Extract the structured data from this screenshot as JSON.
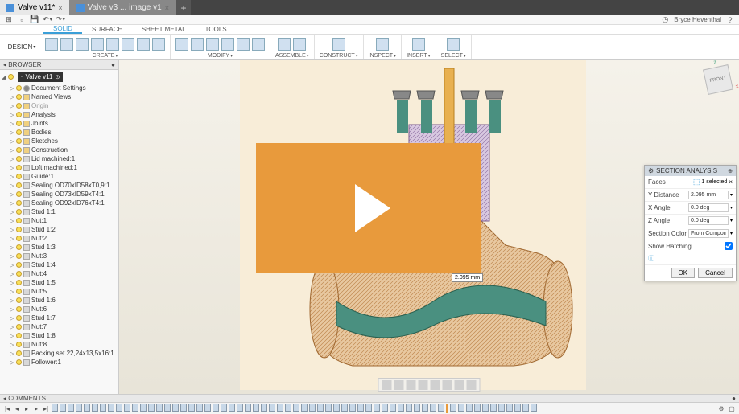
{
  "tabs": [
    {
      "title": "Valve v11*",
      "active": true
    },
    {
      "title": "Valve v3 ... image v1",
      "active": false
    }
  ],
  "user": {
    "name": "Bryce Heventhal"
  },
  "design_dropdown": "DESIGN",
  "mode_tabs": [
    "SOLID",
    "SURFACE",
    "SHEET METAL",
    "TOOLS"
  ],
  "mode_active": 0,
  "ribbon_groups": [
    {
      "label": "CREATE",
      "icon_count": 8
    },
    {
      "label": "MODIFY",
      "icon_count": 6
    },
    {
      "label": "ASSEMBLE",
      "icon_count": 2
    },
    {
      "label": "CONSTRUCT",
      "icon_count": 1
    },
    {
      "label": "INSPECT",
      "icon_count": 1
    },
    {
      "label": "INSERT",
      "icon_count": 1
    },
    {
      "label": "SELECT",
      "icon_count": 1
    }
  ],
  "browser": {
    "title": "BROWSER",
    "root": "Valve v11",
    "items": [
      {
        "label": "Document Settings",
        "type": "gear",
        "arrow": true
      },
      {
        "label": "Named Views",
        "type": "folder",
        "arrow": true
      },
      {
        "label": "Origin",
        "type": "folder",
        "arrow": true,
        "dim": true
      },
      {
        "label": "Analysis",
        "type": "folder",
        "arrow": true
      },
      {
        "label": "Joints",
        "type": "folder",
        "arrow": true
      },
      {
        "label": "Bodies",
        "type": "folder",
        "arrow": true
      },
      {
        "label": "Sketches",
        "type": "folder",
        "arrow": true
      },
      {
        "label": "Construction",
        "type": "folder",
        "arrow": true
      },
      {
        "label": "Lid machined:1",
        "type": "comp",
        "arrow": true
      },
      {
        "label": "Loft machined:1",
        "type": "comp",
        "arrow": true
      },
      {
        "label": "Guide:1",
        "type": "comp",
        "arrow": true
      },
      {
        "label": "Sealing OD70xID58xT0,9:1",
        "type": "comp",
        "arrow": true
      },
      {
        "label": "Sealing OD73xID59xT4:1",
        "type": "comp",
        "arrow": true
      },
      {
        "label": "Sealing OD92xID76xT4:1",
        "type": "comp",
        "arrow": true
      },
      {
        "label": "Stud 1:1",
        "type": "comp",
        "arrow": true
      },
      {
        "label": "Nut:1",
        "type": "comp",
        "arrow": true
      },
      {
        "label": "Stud 1:2",
        "type": "comp",
        "arrow": true
      },
      {
        "label": "Nut:2",
        "type": "comp",
        "arrow": true
      },
      {
        "label": "Stud 1:3",
        "type": "comp",
        "arrow": true
      },
      {
        "label": "Nut:3",
        "type": "comp",
        "arrow": true
      },
      {
        "label": "Stud 1:4",
        "type": "comp",
        "arrow": true
      },
      {
        "label": "Nut:4",
        "type": "comp",
        "arrow": true
      },
      {
        "label": "Stud 1:5",
        "type": "comp",
        "arrow": true
      },
      {
        "label": "Nut:5",
        "type": "comp",
        "arrow": true
      },
      {
        "label": "Stud 1:6",
        "type": "comp",
        "arrow": true
      },
      {
        "label": "Nut:6",
        "type": "comp",
        "arrow": true
      },
      {
        "label": "Stud 1:7",
        "type": "comp",
        "arrow": true
      },
      {
        "label": "Nut:7",
        "type": "comp",
        "arrow": true
      },
      {
        "label": "Stud 1:8",
        "type": "comp",
        "arrow": true
      },
      {
        "label": "Nut:8",
        "type": "comp",
        "arrow": true
      },
      {
        "label": "Packing set 22,24x13,5x16:1",
        "type": "comp",
        "arrow": true
      },
      {
        "label": "Follower:1",
        "type": "comp",
        "arrow": true
      }
    ]
  },
  "comments_label": "COMMENTS",
  "section_panel": {
    "title": "SECTION ANALYSIS",
    "faces_label": "Faces",
    "faces_value": "1 selected",
    "rows": [
      {
        "label": "Y Distance",
        "value": "2.095 mm"
      },
      {
        "label": "X Angle",
        "value": "0.0 deg"
      },
      {
        "label": "Z Angle",
        "value": "0.0 deg"
      },
      {
        "label": "Section Color",
        "value": "From Component"
      }
    ],
    "hatching_label": "Show Hatching",
    "hatching_checked": true,
    "ok": "OK",
    "cancel": "Cancel"
  },
  "viewcube": {
    "face": "FRONT",
    "z": "z",
    "x": "x"
  },
  "dimension_callout": "2.095 mm",
  "timeline_count": 60
}
